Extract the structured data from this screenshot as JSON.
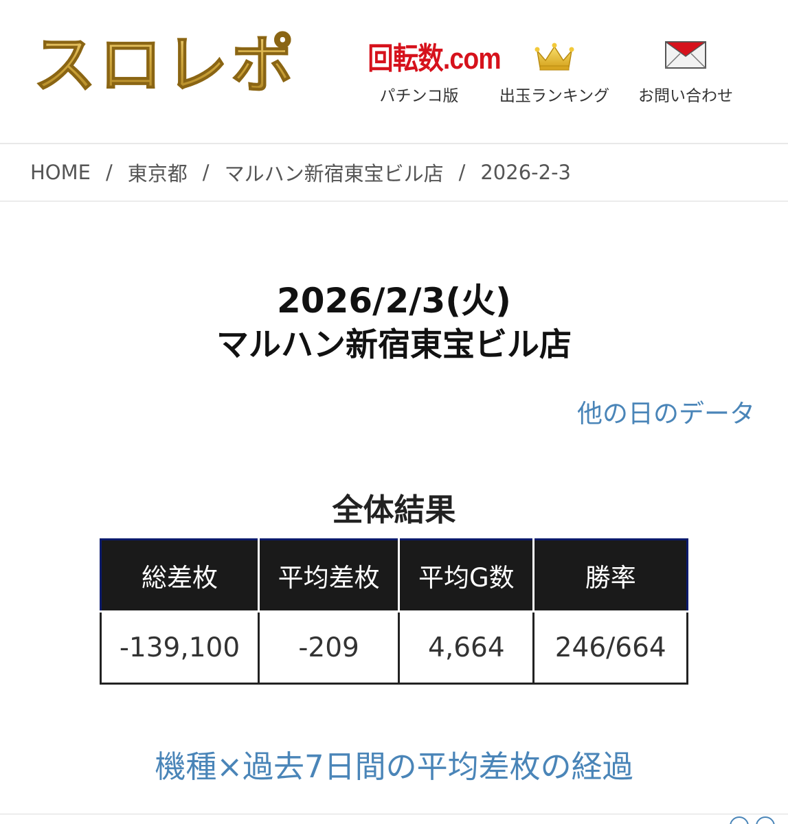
{
  "header": {
    "logo": "スロレポ",
    "nav": [
      {
        "logo_text": "回転数.com",
        "label": "パチンコ版",
        "icon": "kaitensu-logo"
      },
      {
        "label": "出玉ランキング",
        "icon": "crown-icon"
      },
      {
        "label": "お問い合わせ",
        "icon": "mail-icon"
      }
    ]
  },
  "breadcrumb": {
    "items": [
      "HOME",
      "東京都",
      "マルハン新宿東宝ビル店",
      "2026-2-3"
    ],
    "separator": "/"
  },
  "title": {
    "date": "2026/2/3(火)",
    "store": "マルハン新宿東宝ビル店"
  },
  "other_days_link": "他の日のデータ",
  "summary": {
    "heading": "全体結果",
    "columns": [
      "総差枚",
      "平均差枚",
      "平均G数",
      "勝率"
    ],
    "values": [
      "-139,100",
      "-209",
      "4,664",
      "246/664"
    ]
  },
  "section_link": "機種×過去7日間の平均差枚の経過",
  "colors": {
    "logo_gold": "#c9a030",
    "kaitensu_red": "#d6121c",
    "link_blue": "#4a85b8",
    "table_header_bg": "#1a1a1a"
  }
}
